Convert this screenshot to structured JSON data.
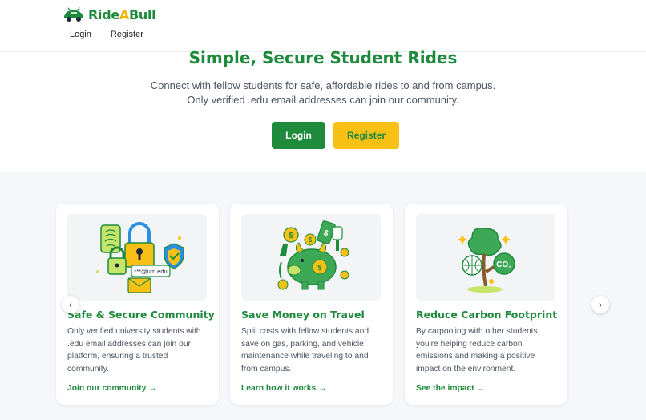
{
  "brand": {
    "name_part1": "Ride",
    "name_part2": "A",
    "name_part3": "Bull",
    "logo_icon": "bull-car-logo"
  },
  "nav": {
    "login": "Login",
    "register": "Register"
  },
  "hero": {
    "title": "Simple, Secure Student Rides",
    "subtitle": "Connect with fellow students for safe, affordable rides to and from campus. Only verified .edu email addresses can join our community.",
    "login_button": "Login",
    "register_button": "Register"
  },
  "features": [
    {
      "title": "Safe & Secure Community",
      "text": "Only verified university students with .edu email addresses can join our platform, ensuring a trusted community.",
      "link": "Join our community →",
      "illustration_caption": "***@um.edu",
      "icon": "security-lock-illustration"
    },
    {
      "title": "Save Money on Travel",
      "text": "Split costs with fellow students and save on gas, parking, and vehicle maintenance while traveling to and from campus.",
      "link": "Learn how it works →",
      "icon": "piggy-bank-illustration"
    },
    {
      "title": "Reduce Carbon Footprint",
      "text": "By carpooling with other students, you're helping reduce carbon emissions and making a positive impact on the environment.",
      "link": "See the impact →",
      "illustration_caption": "CO₂",
      "icon": "tree-globe-illustration"
    }
  ],
  "carousel": {
    "prev_icon": "chevron-left-icon",
    "next_icon": "chevron-right-icon",
    "prev_glyph": "‹",
    "next_glyph": "›"
  },
  "colors": {
    "primary": "#1e8a3c",
    "accent": "#f9c116",
    "section_bg": "#f5f7fa"
  }
}
